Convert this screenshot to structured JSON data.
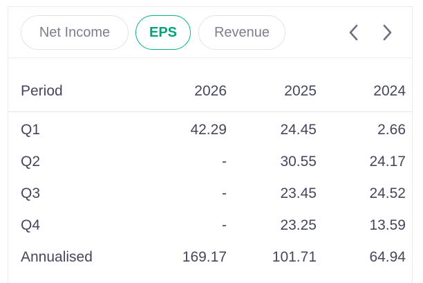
{
  "tabs": [
    {
      "label": "Net Income",
      "active": false
    },
    {
      "label": "EPS",
      "active": true
    },
    {
      "label": "Revenue",
      "active": false
    }
  ],
  "nav": {
    "prev_icon": "chevron-left-icon",
    "next_icon": "chevron-right-icon"
  },
  "table": {
    "headers": [
      "Period",
      "2026",
      "2025",
      "2024"
    ],
    "rows": [
      [
        "Q1",
        "42.29",
        "24.45",
        "2.66"
      ],
      [
        "Q2",
        "-",
        "30.55",
        "24.17"
      ],
      [
        "Q3",
        "-",
        "23.45",
        "24.52"
      ],
      [
        "Q4",
        "-",
        "23.25",
        "13.59"
      ],
      [
        "Annualised",
        "169.17",
        "101.71",
        "64.94"
      ]
    ]
  },
  "colors": {
    "accent": "#00b386",
    "text": "#44475b",
    "muted": "#7c7e8c",
    "border": "#e3e3e3"
  }
}
